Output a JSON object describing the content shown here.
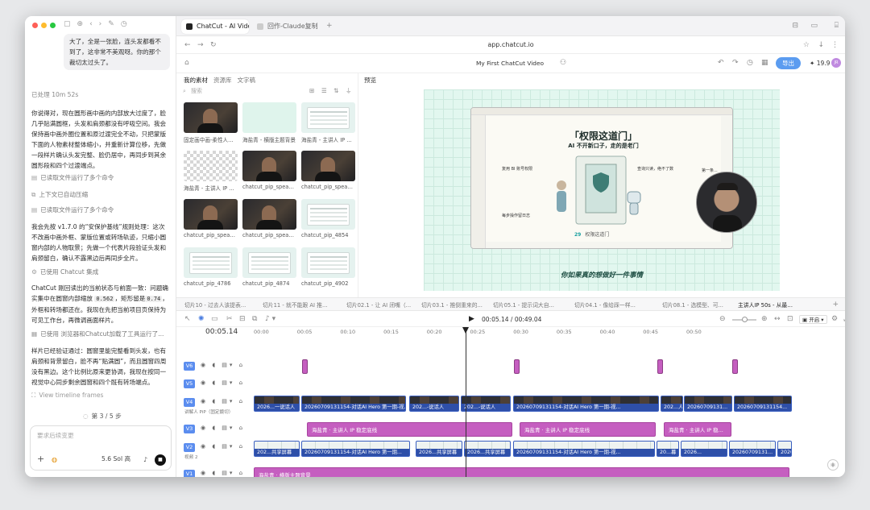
{
  "left_panel": {
    "bubble_text": "大了，全是一张脸，连头发都看不到了，这非常不美观呀。你的那个裁切太过头了。",
    "elapsed": "已处理 10m 52s",
    "msg1": "你说得对，现在圆形画中画的内部放大过度了，脸几乎贴满圆框，头发和肩颈都没有呼吸空间。我会保持画中画外圈位置和原过渡完全不动，只把蒙版下面的人物素材整体缩小，并重新计算位移，先做一段样片确认头发完整、脸仍居中，再同步到其余圆形段和四个过渡端点。",
    "tool1": "已读取文件运行了多个命令",
    "tool2": "上下文已自动压缩",
    "tool3": "已读取文件运行了多个命令",
    "msg2_pre": "我会先按 v1.7.0 的“安保护基线”规则处理：这次不改画中画外框、蒙版位置或转场轨迹，只缩小圆窗内部的人物取景；先做一个代表片段验证头发和肩颈留白，确认不露黑边后再同步全片。",
    "tool4": "已使用 Chatcut 集成",
    "msg3_a": "ChatCut 刚回读出的当前状态与前面一致：问题确实集中在圆窗内部缩放",
    "msg3_code1": "0.562",
    "msg3_b": "，矩形留是",
    "msg3_code2": "0.74",
    "msg3_c": "，外框和转场都还在。我现在先把当前项目页保持为可见工作台，再微调画面样片。",
    "tool5": "已使用 浏览器和Chatcut加载了工具运行了...",
    "msg4": "样片已经验证通过：圆窗里能完整看到头发，也有肩颈和背景留白，脸不再“贴满圆”，而且圆窗四周没有黑边。这个比例比原来更协调，我现在按同一视觉中心同步剩余圆窗和四个既有转场端点。",
    "view_frames": "View timeline frames",
    "step": "第 3 / 5 步",
    "composer_placeholder": "要求后续变更",
    "model_label": "5.6 Sol 高",
    "toolbar_icons": [
      "sidebar-icon",
      "new-chat-icon",
      "back-icon",
      "forward-icon",
      "compose-icon",
      "history-icon"
    ]
  },
  "browser": {
    "tabs": [
      {
        "title": "ChatCut - AI Video Editor",
        "active": true
      },
      {
        "title": "回作-Claude复制",
        "active": false
      }
    ],
    "url": "app.chatcut.io"
  },
  "app": {
    "project_title": "My First ChatCut Video",
    "export_label": "导出",
    "credits": "19.9",
    "user_initials": "JR",
    "media_tabs": [
      "我的素材",
      "资源库",
      "文字稿"
    ],
    "search_placeholder": "搜索",
    "preview_label": "预览",
    "media_items": [
      {
        "caption": "固定画中画-柔性人...",
        "kind": "dark"
      },
      {
        "caption": "海盐青 - 横版主题背景",
        "kind": "mint"
      },
      {
        "caption": "海盐青 - 主讲人 IP ...",
        "kind": "light"
      },
      {
        "caption": "海盐青 - 主讲人 IP ...",
        "kind": "check"
      },
      {
        "caption": "chatcut_pip_speak...",
        "kind": "dark"
      },
      {
        "caption": "chatcut_pip_speak...",
        "kind": "dark"
      },
      {
        "caption": "chatcut_pip_speak...",
        "kind": "dark"
      },
      {
        "caption": "chatcut_pip_speak...",
        "kind": "dark"
      },
      {
        "caption": "chatcut_pip_4854",
        "kind": "light"
      },
      {
        "caption": "chatcut_pip_4786",
        "kind": "light"
      },
      {
        "caption": "chatcut_pip_4874",
        "kind": "light"
      },
      {
        "caption": "chatcut_pip_4902",
        "kind": "light"
      }
    ],
    "slide": {
      "title": "「权限这道门」",
      "subtitle": "AI 不开新口子，走的是老门",
      "label_a": "复用 BI 账号权限",
      "label_b": "查询只读，绝不了数",
      "label_c": "每步操作留日志",
      "label_d": "第一条...",
      "page": "29",
      "page_label": "权限这道门"
    },
    "video_subtitle": "你如果真的想做好一件事情"
  },
  "timeline": {
    "clip_tabs": [
      {
        "label": "切片10 - 过去人该提表...",
        "active": false
      },
      {
        "label": "切片11 - 就不能跟 AI 推...",
        "active": false
      },
      {
        "label": "切片02.1 - 让 AI 闭嘴（...",
        "active": false
      },
      {
        "label": "切片03.1 - 推倒重来的...",
        "active": false
      },
      {
        "label": "切片05.1 - 提示词大自...",
        "active": false
      },
      {
        "label": "切片04.1 - 像给踩一样...",
        "active": false
      },
      {
        "label": "切片08.1 - 选模型、可...",
        "active": false
      },
      {
        "label": "主讲人IP 50s - 从最…",
        "active": true
      }
    ],
    "current_time": "00:05.14",
    "time_display": "00:05.14 / 00:49.04",
    "mode": "开启",
    "ruler": [
      "00:00",
      "00:05",
      "00:10",
      "00:15",
      "00:20",
      "00:25",
      "00:30",
      "00:35",
      "00:40",
      "00:45",
      "00:50"
    ],
    "tracks": [
      {
        "id": "V6",
        "sub": ""
      },
      {
        "id": "V5",
        "sub": ""
      },
      {
        "id": "V4",
        "sub": "讲解人 PiP（固定鏡切）"
      },
      {
        "id": "V3",
        "sub": ""
      },
      {
        "id": "V2",
        "sub": "视频 2"
      },
      {
        "id": "V1",
        "sub": ""
      }
    ],
    "v4_clips": [
      "2026...一说话人",
      "20260709131154-对话AI Hero 第一期-视...",
      "202...-说话人",
      "202...-说话人",
      "20260709131154-对话AI Hero 第一期-视...",
      "202...人",
      "20260709131...",
      "20260709131154..."
    ],
    "v3_clips": [
      "海盐青 · 主讲人 IP 稳定底线",
      "海盐青 · 主讲人 IP 稳定底线",
      "海盐青 · 主讲人 IP 稳..."
    ],
    "v2_clips": [
      "202...共享屏幕",
      "20260709131154-对话AI Hero 第一期...",
      "2026...共享屏幕",
      "2026...共享屏幕",
      "20260709131154-对话AI Hero 第一期-视...",
      "20...幕",
      "2026...",
      "20260709131...",
      "2026..."
    ],
    "v1_clip": "海盐青 · 横版主题背景"
  },
  "colors": {
    "accent": "#5b8def",
    "clip_blue": "#5b7ed6",
    "clip_pink": "#c55ec0",
    "canvas_mint": "#e2f7ef"
  }
}
